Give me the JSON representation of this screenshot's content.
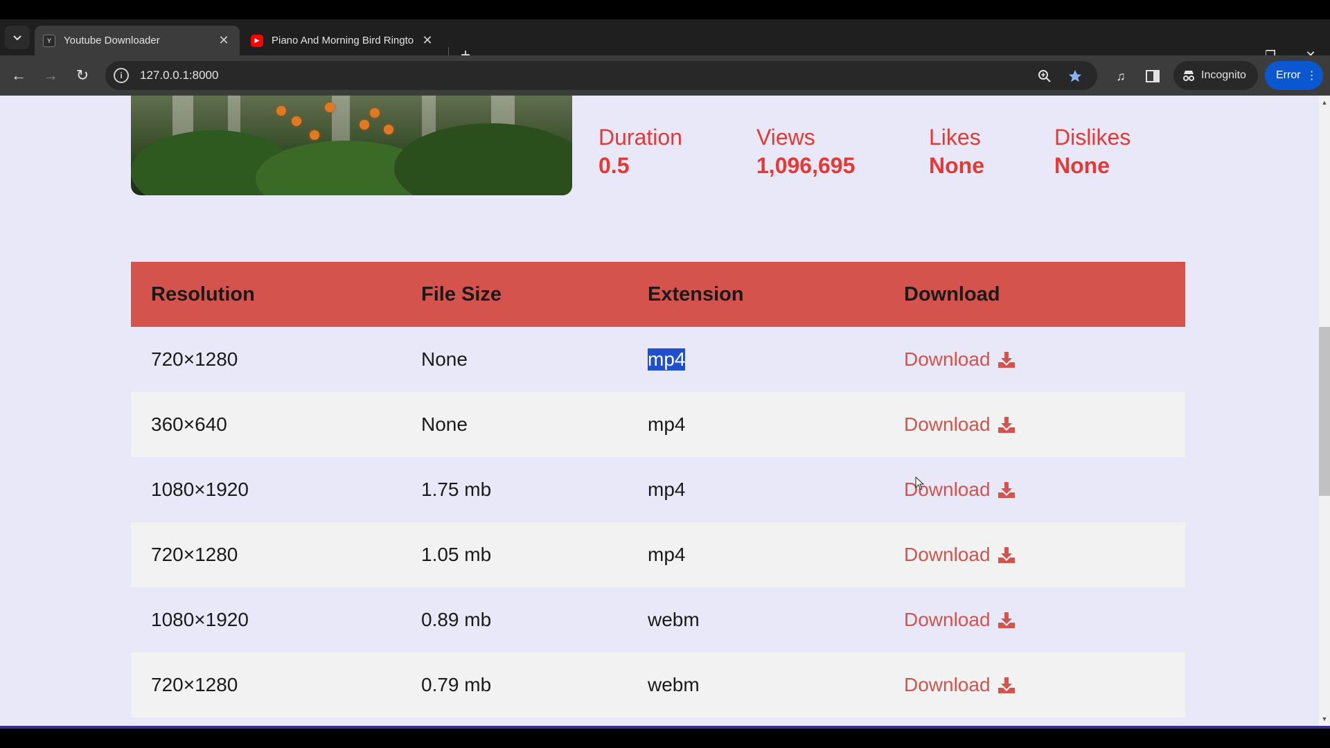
{
  "browser": {
    "tabs": [
      {
        "title": "Youtube Downloader",
        "favicon": "yt-downloader-favicon",
        "active": true
      },
      {
        "title": "Piano And Morning Bird Ringto",
        "favicon": "youtube-favicon",
        "active": false
      }
    ],
    "url": "127.0.0.1:8000",
    "incognito_label": "Incognito",
    "error_label": "Error"
  },
  "video": {
    "stats": [
      {
        "label": "Duration",
        "value": "0.5"
      },
      {
        "label": "Views",
        "value": "1,096,695"
      },
      {
        "label": "Likes",
        "value": "None"
      },
      {
        "label": "Dislikes",
        "value": "None"
      }
    ]
  },
  "table": {
    "headers": [
      "Resolution",
      "File Size",
      "Extension",
      "Download"
    ],
    "rows": [
      {
        "resolution": "720×1280",
        "size": "None",
        "ext": "mp4",
        "download": "Download"
      },
      {
        "resolution": "360×640",
        "size": "None",
        "ext": "mp4",
        "download": "Download"
      },
      {
        "resolution": "1080×1920",
        "size": "1.75 mb",
        "ext": "mp4",
        "download": "Download"
      },
      {
        "resolution": "720×1280",
        "size": "1.05 mb",
        "ext": "mp4",
        "download": "Download"
      },
      {
        "resolution": "1080×1920",
        "size": "0.89 mb",
        "ext": "webm",
        "download": "Download"
      },
      {
        "resolution": "720×1280",
        "size": "0.79 mb",
        "ext": "webm",
        "download": "Download"
      }
    ]
  },
  "colors": {
    "accent_red": "#d4534d",
    "stat_red": "#e53935",
    "page_bg": "#e8e8f8",
    "selection": "#1f4fcc"
  }
}
